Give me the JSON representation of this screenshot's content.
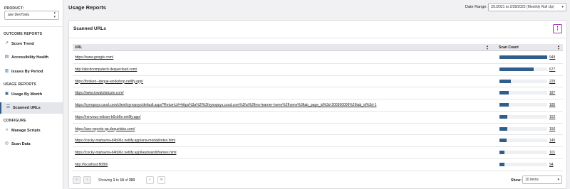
{
  "sidebar": {
    "product_label": "PRODUCT:",
    "product_value": "axe DevTools",
    "sections": [
      {
        "heading": "OUTCOME REPORTS",
        "items": [
          {
            "label": "Score Trend",
            "icon": "trend-icon"
          },
          {
            "label": "Accessibility Health",
            "icon": "accessibility-icon"
          },
          {
            "label": "Issues By Period",
            "icon": "bar-chart-icon"
          }
        ]
      },
      {
        "heading": "USAGE REPORTS",
        "items": [
          {
            "label": "Usage By Month",
            "icon": "calendar-check-icon"
          },
          {
            "label": "Scanned URLs",
            "icon": "list-icon",
            "active": true
          }
        ]
      },
      {
        "heading": "CONFIGURE",
        "items": [
          {
            "label": "Manage Scripts",
            "icon": "code-icon"
          },
          {
            "label": "Scan Data",
            "icon": "database-icon"
          }
        ]
      }
    ]
  },
  "header": {
    "title": "Usage Reports",
    "date_range_label": "Date Range:",
    "date_range_value": "3/1/2021 to 2/28/2022 (Monthly Roll Up)"
  },
  "card": {
    "title": "Scanned URLs",
    "kebab": "⋮"
  },
  "table": {
    "columns": {
      "url": "URL",
      "scan_count": "Scan Count"
    },
    "max_count": 949,
    "rows": [
      {
        "url": "https://www.google.com/",
        "count": 949
      },
      {
        "url": "http://abcdcomputech.dequecloud.com/",
        "count": 677
      },
      {
        "url": "https://broken--deque-workshop.netlify.app/",
        "count": 229
      },
      {
        "url": "https://www.iowatotalcare.com/",
        "count": 187
      },
      {
        "url": "https://synopsys.csod.com/client/synopsys/default.aspx?ReturnUrl=https%3a%2f%2fsynopsys.csod.com%2fui%2flms-learner-home%2fhome%3ftab_page_id%3d-200300006%26tab_id%3d-1",
        "count": 185
      },
      {
        "url": "https://nervous-edison-b0cb6e.netlify.app/",
        "count": 152
      },
      {
        "url": "https://axe-reports-qa.dequelabs.com/",
        "count": 150
      },
      {
        "url": "https://cocky-mahavira-d4b96c.netlify.app/aria-modal/index.html",
        "count": 145
      },
      {
        "url": "https://cocky-mahavira-d4b96c.netlify.app/keyboard/iframes.html",
        "count": 101
      },
      {
        "url": "http://localhost:8080/",
        "count": 94
      }
    ]
  },
  "pagination": {
    "showing_prefix": "Showing",
    "range_start": "1",
    "to_word": "to",
    "range_end": "10",
    "of_word": "of",
    "total": "393",
    "first": "«",
    "prev": "‹",
    "next": "›",
    "last": "»",
    "show_label": "Show:",
    "items_value": "10 items"
  }
}
